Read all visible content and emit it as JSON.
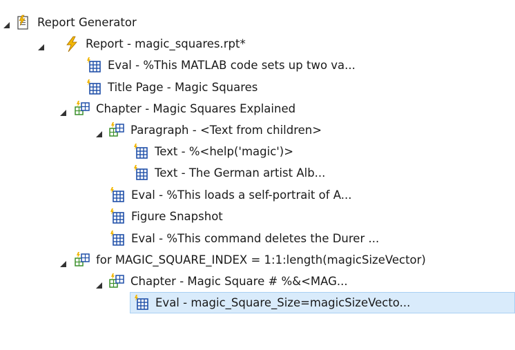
{
  "tree": {
    "nodes": [
      {
        "label": "Report Generator",
        "icon": "report-generator-icon",
        "expanded": true
      },
      {
        "label": "Report - magic_squares.rpt*",
        "icon": "report-icon",
        "expanded": true
      },
      {
        "label": "Eval - %This MATLAB code sets up two va...",
        "icon": "component-icon"
      },
      {
        "label": "Title Page - Magic Squares",
        "icon": "component-icon"
      },
      {
        "label": "Chapter - Magic Squares Explained",
        "icon": "component-parent-icon",
        "expanded": true
      },
      {
        "label": "Paragraph - <Text from children>",
        "icon": "component-parent-icon",
        "expanded": true
      },
      {
        "label": "Text - %<help('magic')>",
        "icon": "component-icon"
      },
      {
        "label": "Text - The German artist Alb...",
        "icon": "component-icon"
      },
      {
        "label": "Eval - %This loads a self-portrait of A...",
        "icon": "component-icon"
      },
      {
        "label": "Figure Snapshot",
        "icon": "component-icon"
      },
      {
        "label": "Eval - %This command deletes the Durer ...",
        "icon": "component-icon"
      },
      {
        "label": "for MAGIC_SQUARE_INDEX = 1:1:length(magicSizeVector)",
        "icon": "component-parent-icon",
        "expanded": true
      },
      {
        "label": "Chapter - Magic Square # %&<MAG...",
        "icon": "component-parent-icon",
        "expanded": true
      },
      {
        "label": "Eval - magic_Square_Size=magicSizeVecto...",
        "icon": "component-icon",
        "selected": true
      }
    ]
  },
  "colors": {
    "selection_bg": "#d9ebfb",
    "selection_border": "#a9d0f3",
    "icon_blue": "#1f4fa8",
    "icon_green": "#3a8f2a",
    "icon_yellow": "#f2b705"
  }
}
